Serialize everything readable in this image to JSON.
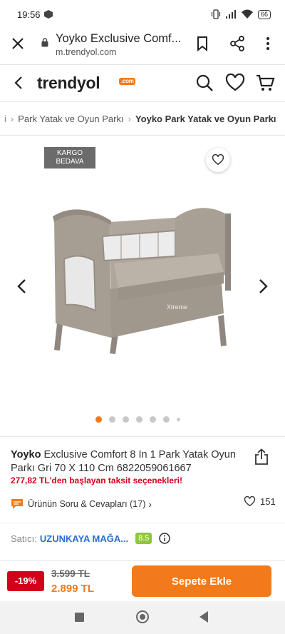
{
  "status_bar": {
    "time": "19:56",
    "battery": "66"
  },
  "browser": {
    "title": "Yoyko Exclusive Comf...",
    "url": "m.trendyol.com"
  },
  "header": {
    "logo": "trendyol",
    "logo_suffix": ".com"
  },
  "breadcrumb": {
    "lead": "i",
    "items": [
      "Park Yatak ve Oyun Parkı"
    ],
    "current": "Yoyko Park Yatak ve Oyun Parkı"
  },
  "gallery": {
    "badge_line1": "KARGO",
    "badge_line2": "BEDAVA",
    "image_brand_text": "Xtreme",
    "dots_total": 7,
    "active_dot": 1
  },
  "product": {
    "brand": "Yoyko",
    "title": "Exclusive Comfort 8 In 1 Park Yatak Oyun Parkı Gri 70 X 110 Cm 6822059061667",
    "installment": "277,82 TL'den başlayan taksit seçenekleri!",
    "qa_label": "Ürünün Soru & Cevapları (17)",
    "favorite_count": "151"
  },
  "seller": {
    "label": "Satıcı:",
    "name": "UZUNKAYA MAĞA...",
    "score": "8.5"
  },
  "price": {
    "discount": "-19%",
    "old": "3.599 TL",
    "new": "2.899 TL",
    "add_to_cart": "Sepete Ekle"
  },
  "colors": {
    "brand_orange": "#f27a1a",
    "discount_red": "#d0021b",
    "seller_blue": "#2a6dcb",
    "score_green": "#8ec73f"
  }
}
